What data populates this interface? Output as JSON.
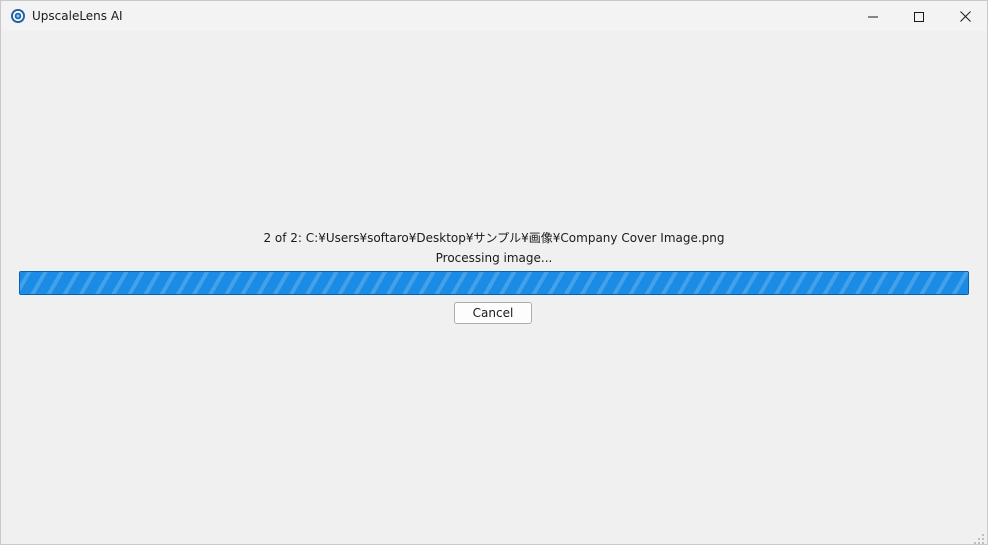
{
  "window": {
    "title": "UpscaleLens AI",
    "icon": "app-logo-icon",
    "controls": [
      "minimize-icon",
      "maximize-icon",
      "close-icon"
    ]
  },
  "progress": {
    "file_label": "2 of 2: C:¥Users¥softaro¥Desktop¥サンプル¥画像¥Company Cover Image.png",
    "status_label": "Processing image...",
    "fraction": 1.0,
    "style": "indeterminate-striped",
    "color": "#1a8ce6"
  },
  "actions": {
    "cancel_label": "Cancel"
  },
  "colors": {
    "background": "#f0f0f0",
    "accent": "#1a8ce6"
  }
}
